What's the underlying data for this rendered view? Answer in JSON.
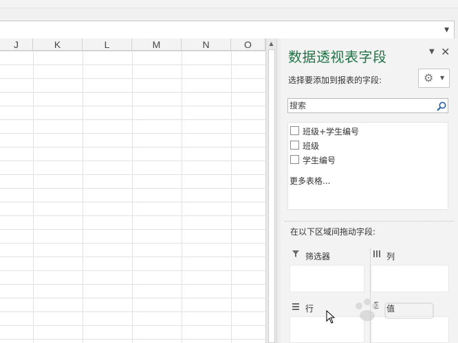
{
  "columns": [
    "J",
    "K",
    "L",
    "M",
    "N",
    "O"
  ],
  "pane": {
    "title": "数据透视表字段",
    "choose_label": "选择要添加到报表的字段:",
    "search_placeholder": "搜索",
    "fields": [
      {
        "label": "班级+学生编号",
        "checked": false
      },
      {
        "label": "班级",
        "checked": false
      },
      {
        "label": "学生编号",
        "checked": false
      }
    ],
    "more_tables": "更多表格...",
    "drag_label": "在以下区域间拖动字段:",
    "areas": {
      "filters": "筛选器",
      "columns": "列",
      "rows": "行",
      "values": "值"
    }
  },
  "colors": {
    "accent": "#217346",
    "pane_bg": "#f3f3f3",
    "gridline": "#e1e1e1"
  },
  "icons": [
    "menu-caret-icon",
    "close-icon",
    "gear-icon",
    "search-icon",
    "filter-icon",
    "columns-icon",
    "rows-icon",
    "sigma-icon"
  ]
}
